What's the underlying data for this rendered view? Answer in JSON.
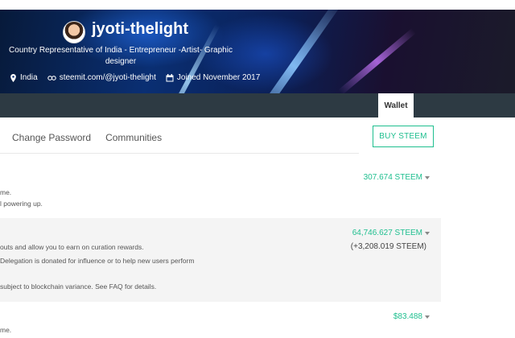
{
  "profile": {
    "username": "jyoti-thelight",
    "bio": "Country Representative of India - Entrepreneur -Artist- Graphic designer",
    "location": "India",
    "website": "steemit.com/@jyoti-thelight",
    "joined": "Joined November 2017",
    "icons": {
      "location": "location-pin-icon",
      "website": "link-icon",
      "joined": "calendar-icon"
    }
  },
  "tabs": {
    "active": "Wallet"
  },
  "subnav": {
    "items": [
      "Change Password",
      "Communities"
    ]
  },
  "actions": {
    "buy_label": "BUY STEEM"
  },
  "wallet": {
    "steem": {
      "amount": "307.674 STEEM",
      "lines": [
        "me.",
        "l powering up."
      ]
    },
    "steem_power": {
      "amount": "64,746.627 STEEM",
      "delegated": "(+3,208.019 STEEM)",
      "lines": [
        "outs and allow you to earn on curation rewards.",
        " Delegation is donated for influence or to help new users perform",
        "subject to blockchain variance. See FAQ for details."
      ]
    },
    "steem_dollars": {
      "amount": "$83.488",
      "lines": [
        "me."
      ]
    }
  },
  "colors": {
    "accent": "#1fbf8f",
    "navbar": "#2d3a43",
    "shaded_row": "#f4f4f4"
  }
}
